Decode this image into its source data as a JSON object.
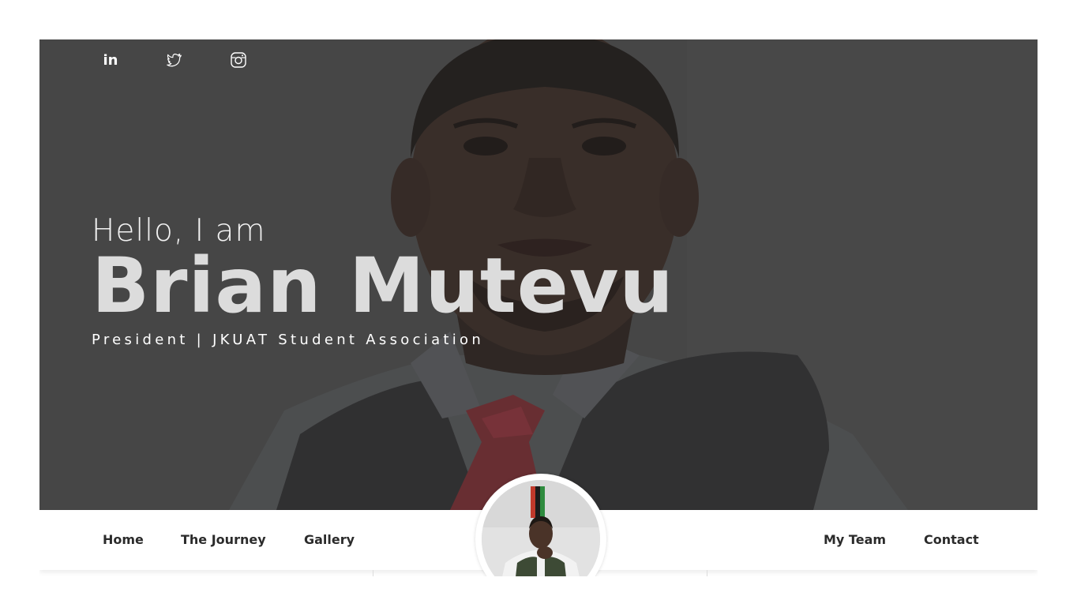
{
  "social": {
    "items": [
      {
        "icon": "linkedin-icon",
        "label": "in"
      },
      {
        "icon": "twitter-icon"
      },
      {
        "icon": "instagram-icon"
      }
    ]
  },
  "hero": {
    "greeting": "Hello, I am",
    "name": "Brian Mutevu",
    "role": "President | JKUAT Student Association"
  },
  "nav": {
    "home": "Home",
    "journey": "The Journey",
    "gallery": "Gallery",
    "team": "My Team",
    "contact": "Contact"
  },
  "colors": {
    "overlay": "#4a4a4a",
    "name_text": "#dcdcdc",
    "nav_text": "#2b2b2b",
    "tie_red": "#b3303a"
  }
}
